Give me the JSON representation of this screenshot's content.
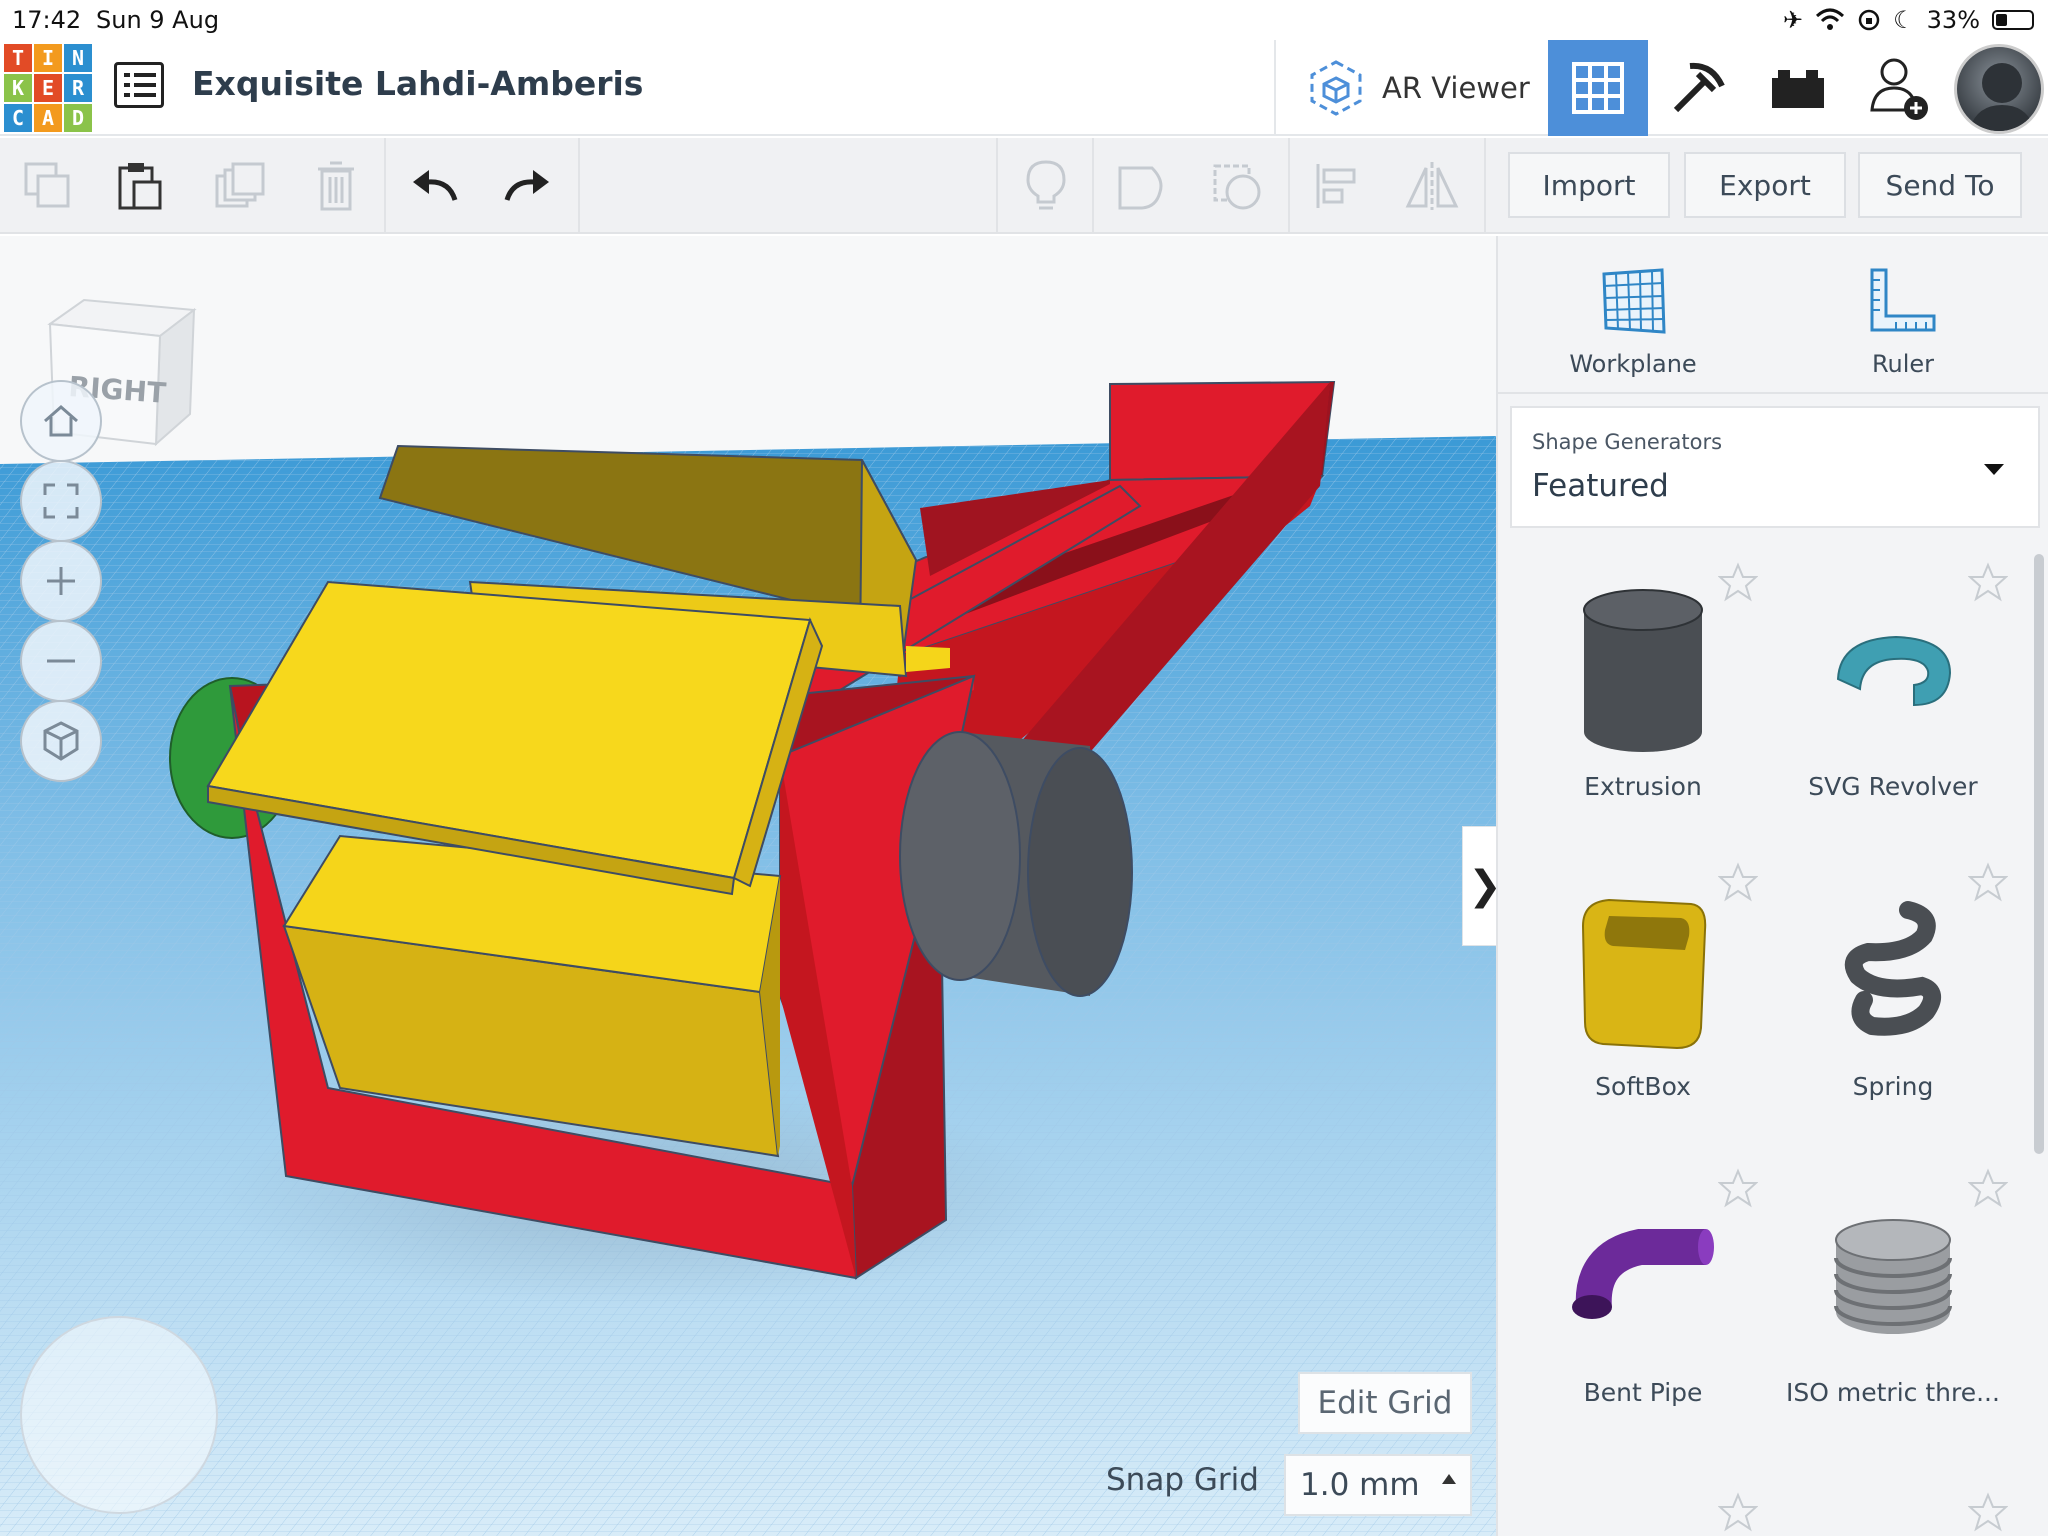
{
  "status_bar": {
    "time": "17:42",
    "date": "Sun 9 Aug",
    "battery": "33%",
    "battery_level": 0.33
  },
  "header": {
    "logo_letters": [
      "T",
      "I",
      "N",
      "K",
      "E",
      "R",
      "C",
      "A",
      "D"
    ],
    "logo_colors": [
      "#e24b26",
      "#f39a1e",
      "#2b8fd0",
      "#8bc34a",
      "#e24b26",
      "#2b8fd0",
      "#2b8fd0",
      "#f39a1e",
      "#8bc34a"
    ],
    "design_title": "Exquisite Lahdi-Amberis",
    "ar_viewer_label": "AR Viewer",
    "accent_color": "#4d8fd9"
  },
  "toolbar": {
    "import_label": "Import",
    "export_label": "Export",
    "send_to_label": "Send To"
  },
  "viewport": {
    "viewcube_label": "RIGHT",
    "edit_grid_label": "Edit Grid",
    "snap_grid_label": "Snap Grid",
    "snap_grid_value": "1.0 mm",
    "collapse_glyph": "❯"
  },
  "panel": {
    "workplane_label": "Workplane",
    "ruler_label": "Ruler",
    "category_label": "Shape Generators",
    "category_value": "Featured",
    "shapes": [
      {
        "name": "Extrusion",
        "icon": "extrusion-shape",
        "color": "#4a4e53"
      },
      {
        "name": "SVG Revolver",
        "icon": "svg-revolver-shape",
        "color": "#3f9fb2"
      },
      {
        "name": "SoftBox",
        "icon": "softbox-shape",
        "color": "#d9b515"
      },
      {
        "name": "Spring",
        "icon": "spring-shape",
        "color": "#4a4e53"
      },
      {
        "name": "Bent Pipe",
        "icon": "bent-pipe-shape",
        "color": "#6c2a9a"
      },
      {
        "name": "ISO metric thre...",
        "icon": "iso-thread-shape",
        "color": "#9a9da1"
      }
    ]
  }
}
